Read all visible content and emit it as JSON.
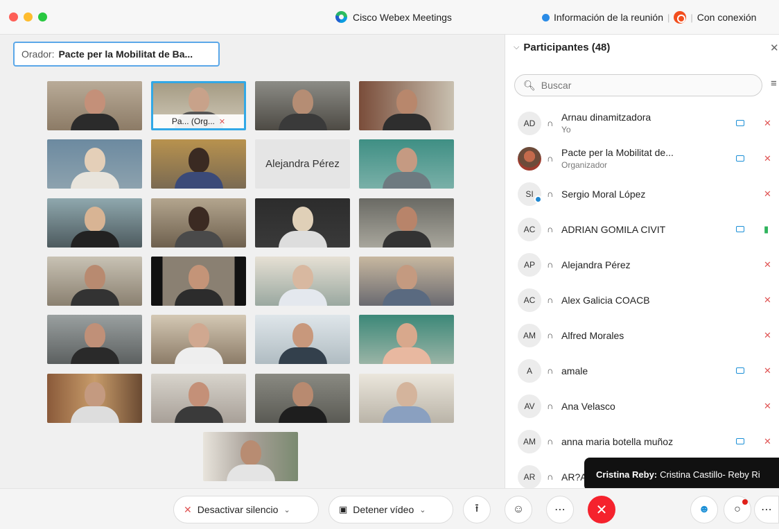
{
  "titlebar": {
    "app_title": "Cisco Webex Meetings",
    "meeting_info": "Información de la reunión",
    "connection": "Con conexión"
  },
  "speaker": {
    "label": "Orador:",
    "name": "Pacte per la Mobilitat de Ba..."
  },
  "grid": {
    "active_tile_label": "Pa...  (Org...",
    "no_video_tile_name": "Alejandra Pérez"
  },
  "panel": {
    "title": "Participantes (48)",
    "search_placeholder": "Buscar",
    "participants": [
      {
        "initials": "AD",
        "name": "Arnau dinamitzadora",
        "sub": "Yo",
        "video": true,
        "mic": "muted"
      },
      {
        "initials": "",
        "name": "Pacte per la Mobilitat de...",
        "sub": "Organizador",
        "video": true,
        "mic": "muted"
      },
      {
        "initials": "SI",
        "name": "Sergio Moral López",
        "sub": "",
        "video": false,
        "mic": "muted"
      },
      {
        "initials": "AC",
        "name": "ADRIAN GOMILA CIVIT",
        "sub": "",
        "video": true,
        "mic": "on"
      },
      {
        "initials": "AP",
        "name": "Alejandra Pérez",
        "sub": "",
        "video": false,
        "mic": "muted"
      },
      {
        "initials": "AC",
        "name": "Alex Galicia COACB",
        "sub": "",
        "video": false,
        "mic": "muted"
      },
      {
        "initials": "AM",
        "name": "Alfred Morales",
        "sub": "",
        "video": false,
        "mic": "muted"
      },
      {
        "initials": "A",
        "name": "amale",
        "sub": "",
        "video": true,
        "mic": "muted"
      },
      {
        "initials": "AV",
        "name": "Ana Velasco",
        "sub": "",
        "video": false,
        "mic": "muted"
      },
      {
        "initials": "AM",
        "name": "anna maria botella muñoz",
        "sub": "",
        "video": true,
        "mic": "muted"
      },
      {
        "initials": "AR",
        "name": "AR?A",
        "sub": "",
        "video": false,
        "mic": ""
      }
    ]
  },
  "tooltip": {
    "sender": "Cristina Reby:",
    "message": "Cristina Castillo- Reby Ri"
  },
  "toolbar": {
    "unmute_label": "Desactivar silencio",
    "stop_video_label": "Detener vídeo"
  },
  "colors": {
    "accent": "#31a8e6",
    "end_call": "#f5222d",
    "muted": "#e05555",
    "mic_on": "#2fb35c"
  }
}
